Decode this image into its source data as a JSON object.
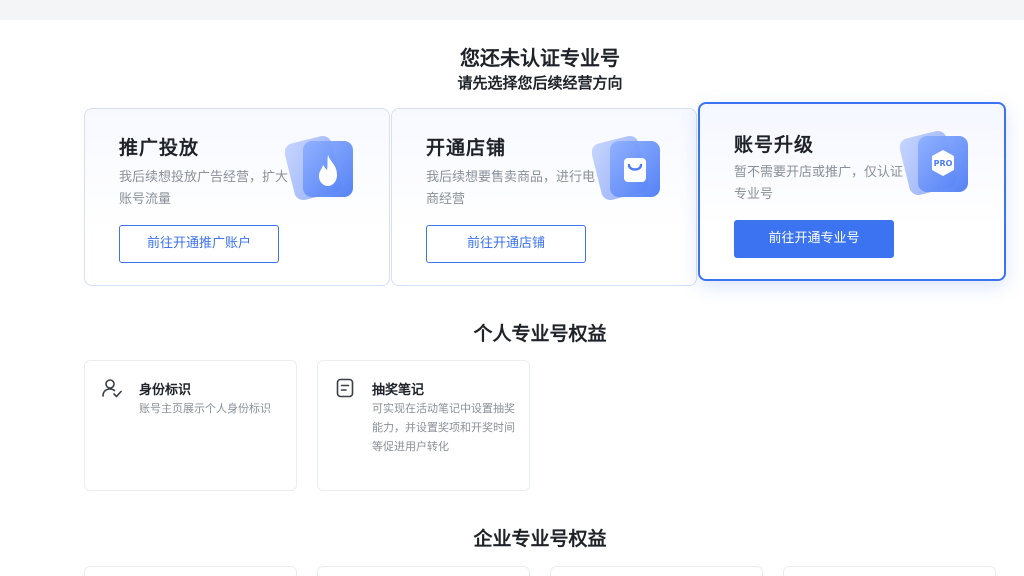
{
  "header": {
    "title": "您还未认证专业号",
    "subtitle": "请先选择您后续经营方向"
  },
  "cards": [
    {
      "title": "推广投放",
      "desc": "我后续想投放广告经营，扩大账号流量",
      "button": "前往开通推广账户",
      "icon": "flame-icon"
    },
    {
      "title": "开通店铺",
      "desc": "我后续想要售卖商品，进行电商经营",
      "button": "前往开通店铺",
      "icon": "shopping-bag-icon"
    },
    {
      "title": "账号升级",
      "desc": "暂不需要开店或推广，仅认证专业号",
      "button": "前往开通专业号",
      "icon": "pro-badge-icon",
      "badge_text": "PRO",
      "selected": true
    }
  ],
  "personal": {
    "title": "个人专业号权益",
    "items": [
      {
        "title": "身份标识",
        "desc": "账号主页展示个人身份标识",
        "icon": "user-check-icon"
      },
      {
        "title": "抽奖笔记",
        "desc": "可实现在活动笔记中设置抽奖能力，并设置奖项和开奖时间等促进用户转化",
        "icon": "note-icon"
      }
    ]
  },
  "enterprise": {
    "title": "企业专业号权益"
  },
  "colors": {
    "accent": "#3b73f0",
    "card_border": "#d6e0f5",
    "text_primary": "#1f2329",
    "text_secondary": "#8a9099"
  }
}
